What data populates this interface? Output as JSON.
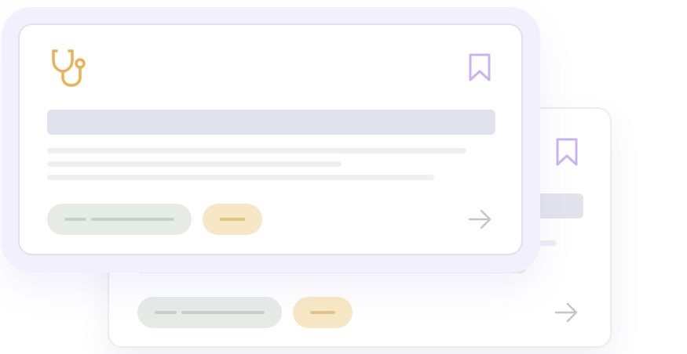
{
  "illustration": "card-stack-placeholder",
  "colors": {
    "accent_purple": "#c8b4f2",
    "icon_orange": "#eab257",
    "skeleton_grey": "#e2e2ec",
    "skeleton_light": "#eeeef3",
    "pill_grey": "#e6ebe8",
    "pill_yellow": "#f7e8c5",
    "arrow_grey": "#c4c4cc",
    "card_border": "#e4dcf8",
    "glow": "#f3f0fd"
  },
  "front_card": {
    "icon": "stethoscope-icon",
    "bookmark_icon": "bookmark-icon",
    "arrow_icon": "arrow-right-icon"
  },
  "back_card": {
    "bookmark_icon": "bookmark-icon",
    "arrow_icon": "arrow-right-icon"
  }
}
